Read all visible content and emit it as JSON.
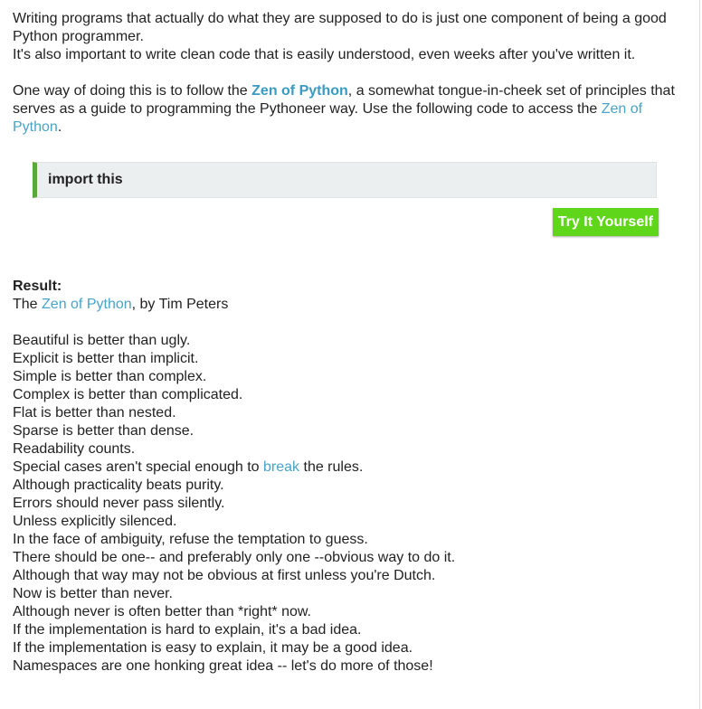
{
  "intro": {
    "p1_line1": "Writing programs that actually do what they are supposed to do is just one component of being a good Python programmer.",
    "p1_line2": "It's also important to write clean code that is easily understood, even weeks after you've written it.",
    "p2_before": "One way of doing this is to follow the ",
    "p2_link1": "Zen of Python",
    "p2_middle": ", a somewhat tongue-in-cheek set of principles that serves as a guide to programming the Pythoneer way. Use the following code to access the ",
    "p2_link2": "Zen of Python",
    "p2_end": "."
  },
  "code": {
    "text": "import this"
  },
  "button": {
    "label": "Try It Yourself"
  },
  "result": {
    "label": "Result:",
    "byline_before": "The ",
    "byline_link": "Zen of Python",
    "byline_after": ", by Tim Peters",
    "lines": [
      "Beautiful is better than ugly.",
      "Explicit is better than implicit.",
      "Simple is better than complex.",
      "Complex is better than complicated.",
      "Flat is better than nested.",
      "Sparse is better than dense.",
      "Readability counts.",
      "Special cases aren't special enough to break the rules.",
      "Although practicality beats purity.",
      "Errors should never pass silently.",
      "Unless explicitly silenced.",
      "In the face of ambiguity, refuse the temptation to guess.",
      "There should be one-- and preferably only one --obvious way to do it.",
      "Although that way may not be obvious at first unless you're Dutch.",
      "Now is better than never.",
      "Although never is often better than *right* now.",
      "If the implementation is hard to explain, it's a bad idea.",
      "If the implementation is easy to explain, it may be a good idea.",
      "Namespaces are one honking great idea -- let's do more of those!"
    ],
    "special_line": {
      "before": "Special cases aren't special enough to ",
      "link": "break",
      "after": " the rules."
    }
  },
  "colors": {
    "link": "#4aa3c8",
    "button_bg": "#5fd61a",
    "code_border": "#5aa93a",
    "code_bg": "#ecefef"
  }
}
